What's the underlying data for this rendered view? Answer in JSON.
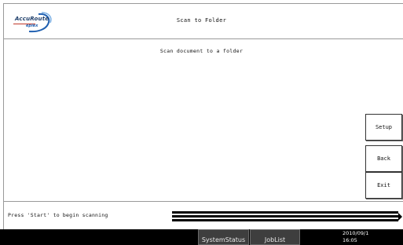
{
  "app": {
    "logo_text": "AccuRoute",
    "logo_sub": "eplex",
    "title": "Scan to Folder",
    "subtitle": "Scan document to a folder"
  },
  "buttons": {
    "setup": "Setup",
    "back": "Back",
    "exit": "Exit"
  },
  "status": {
    "message": "Press 'Start' to begin scanning"
  },
  "taskbar": {
    "system_status": "SystemStatus",
    "job_list": "JobList",
    "date": "2010/09/1",
    "time": "16:05"
  },
  "colors": {
    "taskbar_bg": "#000000",
    "logo_blue": "#1f5fb0",
    "logo_red": "#c0392b"
  }
}
